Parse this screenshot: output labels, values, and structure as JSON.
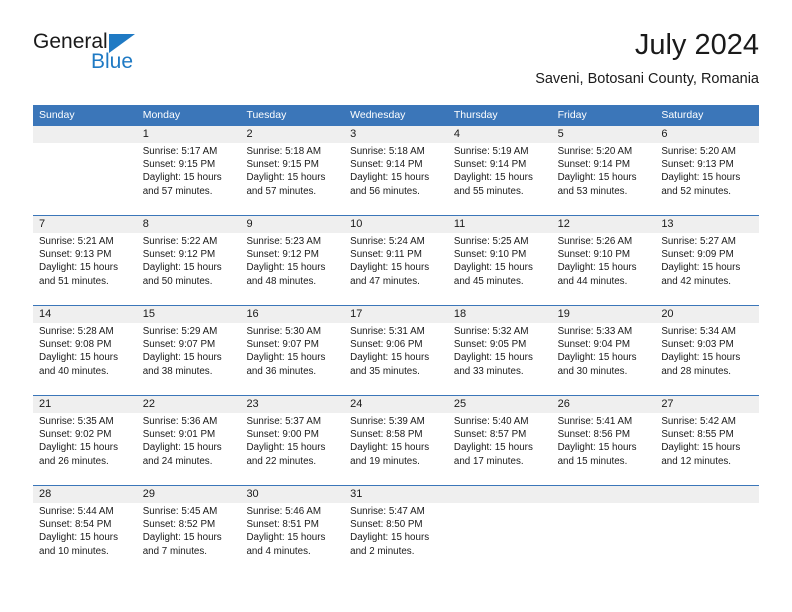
{
  "brand": {
    "name_part1": "General",
    "name_part2": "Blue",
    "triangle_color": "#1f7ac4"
  },
  "header": {
    "title": "July 2024",
    "subtitle": "Saveni, Botosani County, Romania"
  },
  "theme": {
    "header_blue": "#3b76b9",
    "date_band_gray": "#efefef",
    "text_color": "#1a1a1a"
  },
  "weekday_headers": [
    "Sunday",
    "Monday",
    "Tuesday",
    "Wednesday",
    "Thursday",
    "Friday",
    "Saturday"
  ],
  "weeks": [
    {
      "dates": [
        "",
        "1",
        "2",
        "3",
        "4",
        "5",
        "6"
      ],
      "cells": [
        {
          "sunrise": "",
          "sunset": "",
          "daylight_line1": "",
          "daylight_line2": ""
        },
        {
          "sunrise": "Sunrise: 5:17 AM",
          "sunset": "Sunset: 9:15 PM",
          "daylight_line1": "Daylight: 15 hours",
          "daylight_line2": "and 57 minutes."
        },
        {
          "sunrise": "Sunrise: 5:18 AM",
          "sunset": "Sunset: 9:15 PM",
          "daylight_line1": "Daylight: 15 hours",
          "daylight_line2": "and 57 minutes."
        },
        {
          "sunrise": "Sunrise: 5:18 AM",
          "sunset": "Sunset: 9:14 PM",
          "daylight_line1": "Daylight: 15 hours",
          "daylight_line2": "and 56 minutes."
        },
        {
          "sunrise": "Sunrise: 5:19 AM",
          "sunset": "Sunset: 9:14 PM",
          "daylight_line1": "Daylight: 15 hours",
          "daylight_line2": "and 55 minutes."
        },
        {
          "sunrise": "Sunrise: 5:20 AM",
          "sunset": "Sunset: 9:14 PM",
          "daylight_line1": "Daylight: 15 hours",
          "daylight_line2": "and 53 minutes."
        },
        {
          "sunrise": "Sunrise: 5:20 AM",
          "sunset": "Sunset: 9:13 PM",
          "daylight_line1": "Daylight: 15 hours",
          "daylight_line2": "and 52 minutes."
        }
      ]
    },
    {
      "dates": [
        "7",
        "8",
        "9",
        "10",
        "11",
        "12",
        "13"
      ],
      "cells": [
        {
          "sunrise": "Sunrise: 5:21 AM",
          "sunset": "Sunset: 9:13 PM",
          "daylight_line1": "Daylight: 15 hours",
          "daylight_line2": "and 51 minutes."
        },
        {
          "sunrise": "Sunrise: 5:22 AM",
          "sunset": "Sunset: 9:12 PM",
          "daylight_line1": "Daylight: 15 hours",
          "daylight_line2": "and 50 minutes."
        },
        {
          "sunrise": "Sunrise: 5:23 AM",
          "sunset": "Sunset: 9:12 PM",
          "daylight_line1": "Daylight: 15 hours",
          "daylight_line2": "and 48 minutes."
        },
        {
          "sunrise": "Sunrise: 5:24 AM",
          "sunset": "Sunset: 9:11 PM",
          "daylight_line1": "Daylight: 15 hours",
          "daylight_line2": "and 47 minutes."
        },
        {
          "sunrise": "Sunrise: 5:25 AM",
          "sunset": "Sunset: 9:10 PM",
          "daylight_line1": "Daylight: 15 hours",
          "daylight_line2": "and 45 minutes."
        },
        {
          "sunrise": "Sunrise: 5:26 AM",
          "sunset": "Sunset: 9:10 PM",
          "daylight_line1": "Daylight: 15 hours",
          "daylight_line2": "and 44 minutes."
        },
        {
          "sunrise": "Sunrise: 5:27 AM",
          "sunset": "Sunset: 9:09 PM",
          "daylight_line1": "Daylight: 15 hours",
          "daylight_line2": "and 42 minutes."
        }
      ]
    },
    {
      "dates": [
        "14",
        "15",
        "16",
        "17",
        "18",
        "19",
        "20"
      ],
      "cells": [
        {
          "sunrise": "Sunrise: 5:28 AM",
          "sunset": "Sunset: 9:08 PM",
          "daylight_line1": "Daylight: 15 hours",
          "daylight_line2": "and 40 minutes."
        },
        {
          "sunrise": "Sunrise: 5:29 AM",
          "sunset": "Sunset: 9:07 PM",
          "daylight_line1": "Daylight: 15 hours",
          "daylight_line2": "and 38 minutes."
        },
        {
          "sunrise": "Sunrise: 5:30 AM",
          "sunset": "Sunset: 9:07 PM",
          "daylight_line1": "Daylight: 15 hours",
          "daylight_line2": "and 36 minutes."
        },
        {
          "sunrise": "Sunrise: 5:31 AM",
          "sunset": "Sunset: 9:06 PM",
          "daylight_line1": "Daylight: 15 hours",
          "daylight_line2": "and 35 minutes."
        },
        {
          "sunrise": "Sunrise: 5:32 AM",
          "sunset": "Sunset: 9:05 PM",
          "daylight_line1": "Daylight: 15 hours",
          "daylight_line2": "and 33 minutes."
        },
        {
          "sunrise": "Sunrise: 5:33 AM",
          "sunset": "Sunset: 9:04 PM",
          "daylight_line1": "Daylight: 15 hours",
          "daylight_line2": "and 30 minutes."
        },
        {
          "sunrise": "Sunrise: 5:34 AM",
          "sunset": "Sunset: 9:03 PM",
          "daylight_line1": "Daylight: 15 hours",
          "daylight_line2": "and 28 minutes."
        }
      ]
    },
    {
      "dates": [
        "21",
        "22",
        "23",
        "24",
        "25",
        "26",
        "27"
      ],
      "cells": [
        {
          "sunrise": "Sunrise: 5:35 AM",
          "sunset": "Sunset: 9:02 PM",
          "daylight_line1": "Daylight: 15 hours",
          "daylight_line2": "and 26 minutes."
        },
        {
          "sunrise": "Sunrise: 5:36 AM",
          "sunset": "Sunset: 9:01 PM",
          "daylight_line1": "Daylight: 15 hours",
          "daylight_line2": "and 24 minutes."
        },
        {
          "sunrise": "Sunrise: 5:37 AM",
          "sunset": "Sunset: 9:00 PM",
          "daylight_line1": "Daylight: 15 hours",
          "daylight_line2": "and 22 minutes."
        },
        {
          "sunrise": "Sunrise: 5:39 AM",
          "sunset": "Sunset: 8:58 PM",
          "daylight_line1": "Daylight: 15 hours",
          "daylight_line2": "and 19 minutes."
        },
        {
          "sunrise": "Sunrise: 5:40 AM",
          "sunset": "Sunset: 8:57 PM",
          "daylight_line1": "Daylight: 15 hours",
          "daylight_line2": "and 17 minutes."
        },
        {
          "sunrise": "Sunrise: 5:41 AM",
          "sunset": "Sunset: 8:56 PM",
          "daylight_line1": "Daylight: 15 hours",
          "daylight_line2": "and 15 minutes."
        },
        {
          "sunrise": "Sunrise: 5:42 AM",
          "sunset": "Sunset: 8:55 PM",
          "daylight_line1": "Daylight: 15 hours",
          "daylight_line2": "and 12 minutes."
        }
      ]
    },
    {
      "dates": [
        "28",
        "29",
        "30",
        "31",
        "",
        "",
        ""
      ],
      "cells": [
        {
          "sunrise": "Sunrise: 5:44 AM",
          "sunset": "Sunset: 8:54 PM",
          "daylight_line1": "Daylight: 15 hours",
          "daylight_line2": "and 10 minutes."
        },
        {
          "sunrise": "Sunrise: 5:45 AM",
          "sunset": "Sunset: 8:52 PM",
          "daylight_line1": "Daylight: 15 hours",
          "daylight_line2": "and 7 minutes."
        },
        {
          "sunrise": "Sunrise: 5:46 AM",
          "sunset": "Sunset: 8:51 PM",
          "daylight_line1": "Daylight: 15 hours",
          "daylight_line2": "and 4 minutes."
        },
        {
          "sunrise": "Sunrise: 5:47 AM",
          "sunset": "Sunset: 8:50 PM",
          "daylight_line1": "Daylight: 15 hours",
          "daylight_line2": "and 2 minutes."
        },
        {
          "sunrise": "",
          "sunset": "",
          "daylight_line1": "",
          "daylight_line2": ""
        },
        {
          "sunrise": "",
          "sunset": "",
          "daylight_line1": "",
          "daylight_line2": ""
        },
        {
          "sunrise": "",
          "sunset": "",
          "daylight_line1": "",
          "daylight_line2": ""
        }
      ]
    }
  ]
}
